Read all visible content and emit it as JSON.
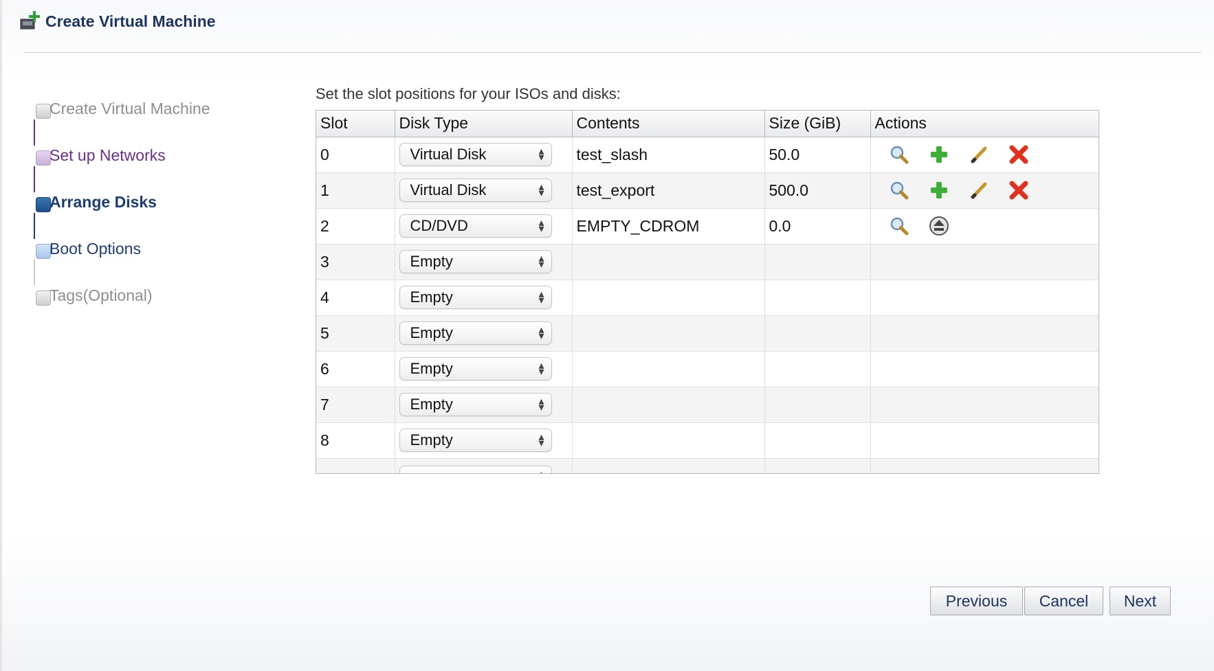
{
  "header": {
    "title": "Create Virtual Machine",
    "icon": "create-vm-icon"
  },
  "wizard_steps": [
    {
      "label": "Create Virtual Machine",
      "state": "disabled"
    },
    {
      "label": "Set up Networks",
      "state": "visited"
    },
    {
      "label": "Arrange Disks",
      "state": "current"
    },
    {
      "label": "Boot Options",
      "state": "next"
    },
    {
      "label": "Tags(Optional)",
      "state": "disabled"
    }
  ],
  "instruction": "Set the slot positions for your ISOs and disks:",
  "table": {
    "columns": [
      "Slot",
      "Disk Type",
      "Contents",
      "Size (GiB)",
      "Actions"
    ],
    "rows": [
      {
        "slot": "0",
        "disk_type": "Virtual Disk",
        "contents": "test_slash",
        "size": "50.0",
        "actions": [
          "search",
          "add",
          "edit",
          "delete"
        ]
      },
      {
        "slot": "1",
        "disk_type": "Virtual Disk",
        "contents": "test_export",
        "size": "500.0",
        "actions": [
          "search",
          "add",
          "edit",
          "delete"
        ]
      },
      {
        "slot": "2",
        "disk_type": "CD/DVD",
        "contents": "EMPTY_CDROM",
        "size": "0.0",
        "actions": [
          "search",
          "eject"
        ]
      },
      {
        "slot": "3",
        "disk_type": "Empty",
        "contents": "",
        "size": "",
        "actions": []
      },
      {
        "slot": "4",
        "disk_type": "Empty",
        "contents": "",
        "size": "",
        "actions": []
      },
      {
        "slot": "5",
        "disk_type": "Empty",
        "contents": "",
        "size": "",
        "actions": []
      },
      {
        "slot": "6",
        "disk_type": "Empty",
        "contents": "",
        "size": "",
        "actions": []
      },
      {
        "slot": "7",
        "disk_type": "Empty",
        "contents": "",
        "size": "",
        "actions": []
      },
      {
        "slot": "8",
        "disk_type": "Empty",
        "contents": "",
        "size": "",
        "actions": []
      },
      {
        "slot": "",
        "disk_type": "",
        "contents": "",
        "size": "",
        "actions": []
      }
    ]
  },
  "buttons": {
    "previous": "Previous",
    "cancel": "Cancel",
    "next": "Next"
  },
  "colors": {
    "title": "#1d3460",
    "step_visited": "#6a2e8c",
    "step_current": "#1d3d74",
    "step_disabled": "#8e8e8e",
    "add_icon": "#3cb034",
    "delete_icon": "#e0301e"
  }
}
